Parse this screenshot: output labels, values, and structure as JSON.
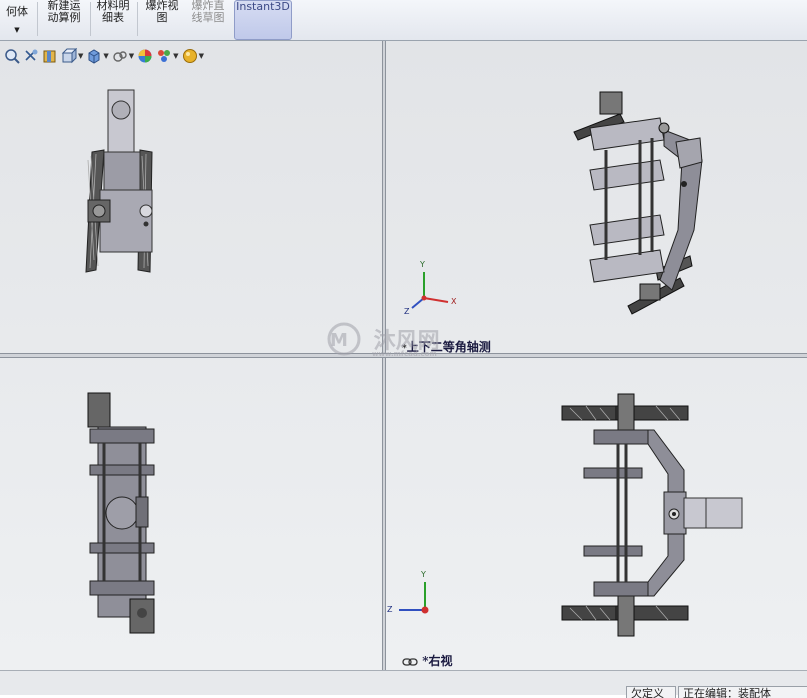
{
  "ribbon": {
    "items": [
      {
        "line1": "何体",
        "line2": ""
      },
      {
        "line1": "新建运",
        "line2": "动算例"
      },
      {
        "line1": "材料明",
        "line2": "细表"
      },
      {
        "line1": "爆炸视",
        "line2": "图"
      },
      {
        "line1": "爆炸直",
        "line2": "线草图"
      },
      {
        "line1": "Instant3D",
        "line2": ""
      }
    ]
  },
  "viewports": {
    "iso_label": "上下二等角轴测",
    "right_label": "*右视"
  },
  "axes": {
    "x": "X",
    "y": "Y",
    "z": "Z"
  },
  "watermark": {
    "brand": "沐风网",
    "url": "www.mfcad.com"
  },
  "status": {
    "left": "欠定义",
    "right": "正在编辑：装配体"
  }
}
